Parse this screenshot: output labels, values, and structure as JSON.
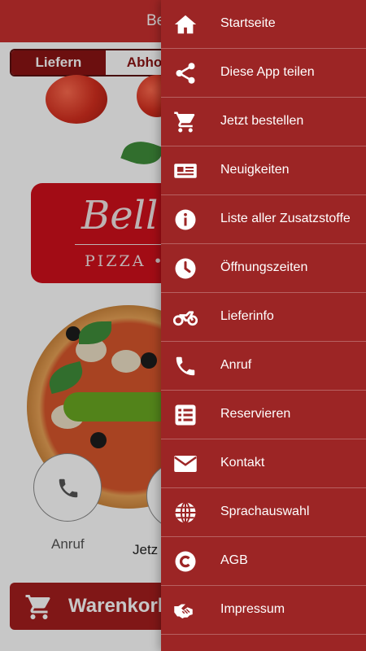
{
  "colors": {
    "header": "#c8302f",
    "drawer": "#9c2525",
    "tab_active": "#8b1414",
    "cart_bar": "#a51e1e",
    "green_button": "#6aa822"
  },
  "header": {
    "title": "Be"
  },
  "tabs": [
    {
      "label": "Liefern",
      "active": true
    },
    {
      "label": "Abho",
      "active": false
    }
  ],
  "logo": {
    "title": "Bell",
    "subtitle": "PIZZA • ("
  },
  "actions": [
    {
      "label": "Anruf",
      "icon": "phone-icon"
    },
    {
      "label": "Jetz",
      "icon": "cart-icon"
    }
  ],
  "cart": {
    "label": "Warenkorb"
  },
  "menu": [
    {
      "label": "Startseite",
      "icon": "home-icon"
    },
    {
      "label": "Diese App teilen",
      "icon": "share-icon"
    },
    {
      "label": "Jetzt bestellen",
      "icon": "cart-icon"
    },
    {
      "label": "Neuigkeiten",
      "icon": "newspaper-icon"
    },
    {
      "label": "Liste aller Zusatzstoffe",
      "icon": "info-icon"
    },
    {
      "label": "Öffnungszeiten",
      "icon": "clock-icon"
    },
    {
      "label": "Lieferinfo",
      "icon": "motorcycle-icon"
    },
    {
      "label": "Anruf",
      "icon": "phone-icon"
    },
    {
      "label": "Reservieren",
      "icon": "list-icon"
    },
    {
      "label": "Kontakt",
      "icon": "envelope-icon"
    },
    {
      "label": "Sprachauswahl",
      "icon": "globe-icon"
    },
    {
      "label": "AGB",
      "icon": "copyright-icon"
    },
    {
      "label": "Impressum",
      "icon": "handshake-icon"
    }
  ]
}
